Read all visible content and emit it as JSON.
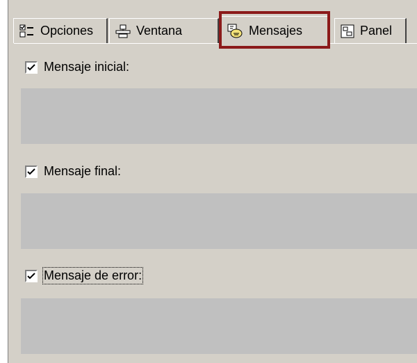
{
  "tabs": [
    {
      "label": "Opciones",
      "icon": "options-list-icon"
    },
    {
      "label": "Ventana",
      "icon": "window-layout-icon"
    },
    {
      "label": "Mensajes",
      "icon": "message-icon",
      "active": true
    },
    {
      "label": "Panel",
      "icon": "panel-icon"
    }
  ],
  "sections": [
    {
      "label": "Mensaje inicial:",
      "checked": true
    },
    {
      "label": "Mensaje final:",
      "checked": true
    },
    {
      "label": "Mensaje de error:",
      "checked": true,
      "focused": true
    }
  ],
  "colors": {
    "highlight": "#8b1a1a",
    "panel": "#d4d0c8",
    "textarea": "#c0c0c0"
  }
}
